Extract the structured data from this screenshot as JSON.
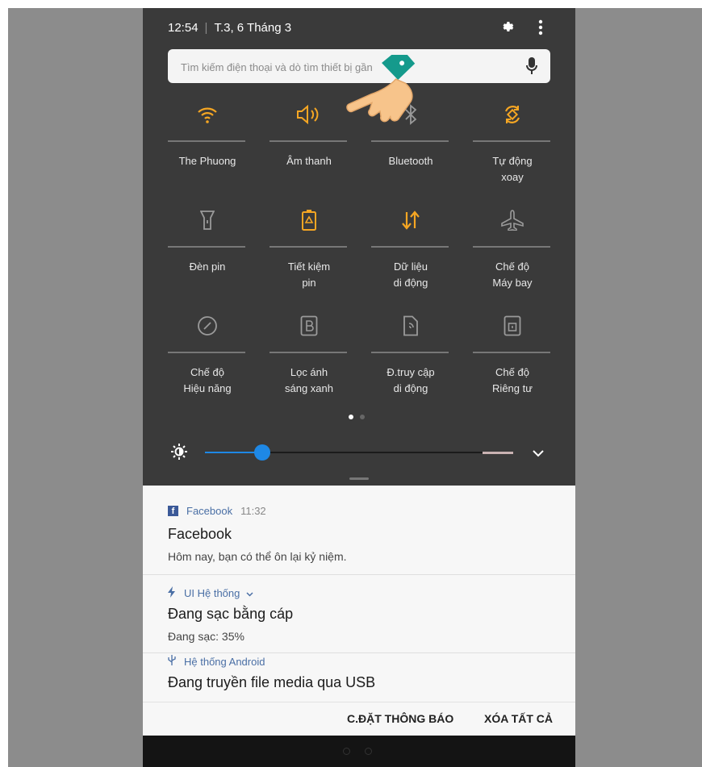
{
  "status": {
    "time": "12:54",
    "date": "T.3, 6 Tháng 3"
  },
  "search": {
    "placeholder": "Tìm kiếm điện thoại và dò tìm thiết bị gần"
  },
  "tiles": [
    {
      "label": "The Phuong",
      "icon": "wifi-icon",
      "active": true
    },
    {
      "label": "Âm thanh",
      "icon": "speaker-icon",
      "active": true
    },
    {
      "label": "Bluetooth",
      "icon": "bluetooth-icon",
      "active": false
    },
    {
      "label": "Tự động\nxoay",
      "icon": "auto-rotate-icon",
      "active": true
    },
    {
      "label": "Đèn pin",
      "icon": "flashlight-icon",
      "active": false
    },
    {
      "label": "Tiết kiệm\npin",
      "icon": "battery-saver-icon",
      "active": true
    },
    {
      "label": "Dữ liệu\ndi động",
      "icon": "mobile-data-icon",
      "active": true
    },
    {
      "label": "Chế độ\nMáy bay",
      "icon": "airplane-icon",
      "active": false
    },
    {
      "label": "Chế độ\nHiệu năng",
      "icon": "performance-gauge-icon",
      "active": false
    },
    {
      "label": "Lọc ánh\nsáng xanh",
      "icon": "blue-light-filter-icon",
      "active": false
    },
    {
      "label": "Đ.truy cập\ndi động",
      "icon": "mobile-hotspot-icon",
      "active": false
    },
    {
      "label": "Chế độ\nRiêng tư",
      "icon": "private-mode-icon",
      "active": false
    }
  ],
  "colors": {
    "active": "#f5a623",
    "inactive": "#9a9a9a",
    "slider": "#1e88e5"
  },
  "brightness": {
    "level": 0.2
  },
  "notifications": [
    {
      "app": "Facebook",
      "time": "11:32",
      "title": "Facebook",
      "text": "Hôm nay, bạn có thể ôn lại kỷ niệm."
    },
    {
      "app": "UI Hệ thống",
      "title": "Đang sạc bằng cáp",
      "text": "Đang sạc: 35%"
    },
    {
      "app": "Hệ thống Android",
      "title": "Đang truyền file media qua USB"
    }
  ],
  "footer": {
    "settings": "C.ĐẶT THÔNG BÁO",
    "clear": "XÓA TẤT CẢ"
  }
}
